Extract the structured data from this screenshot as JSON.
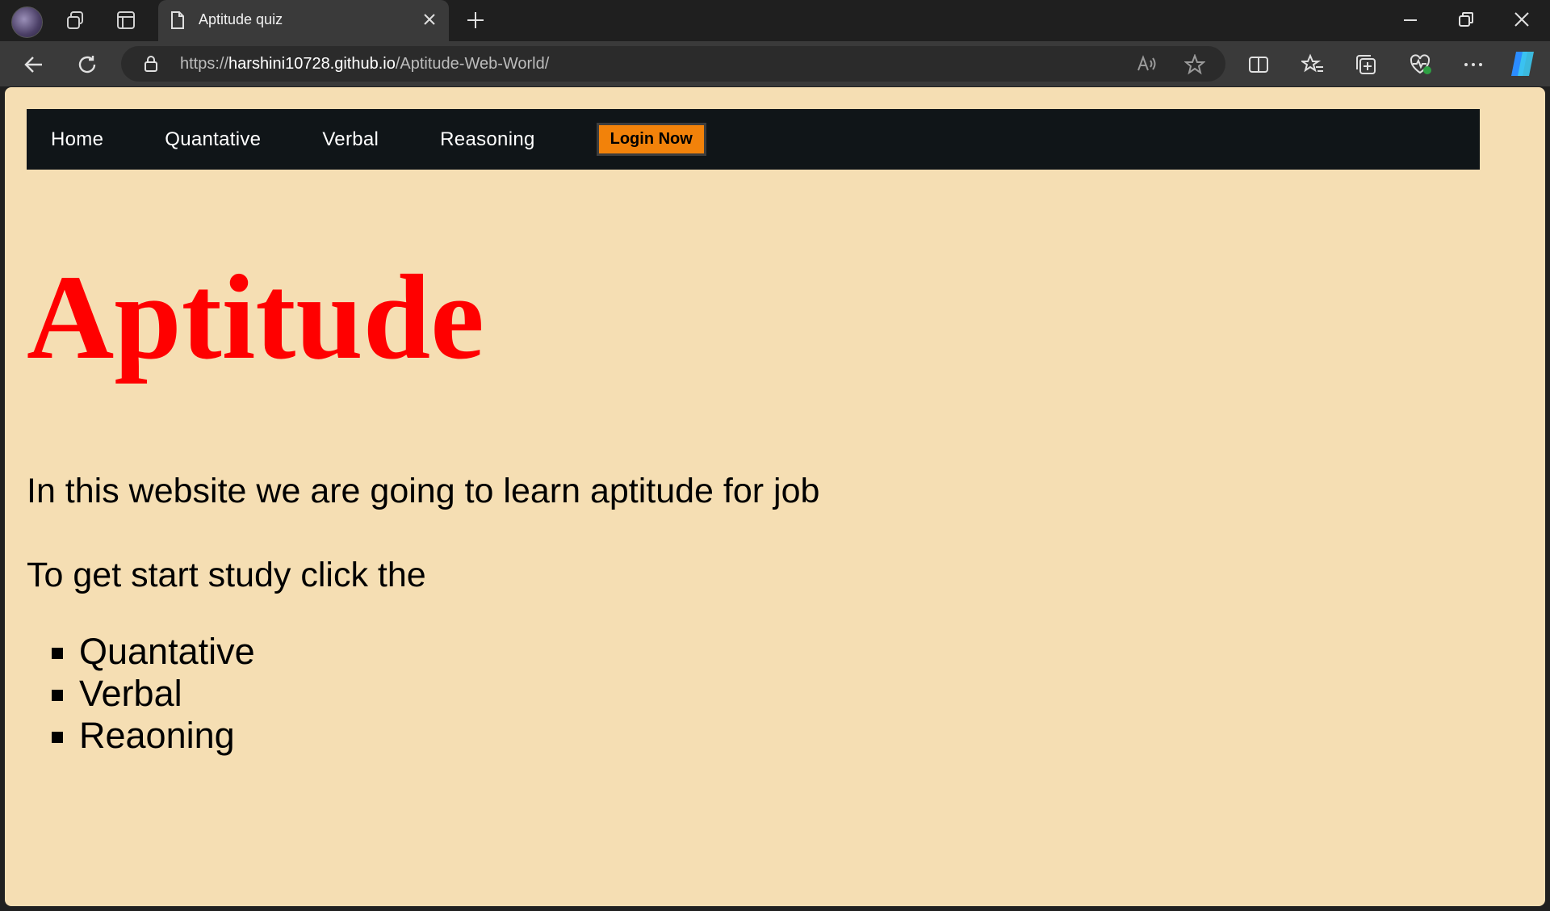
{
  "browser": {
    "tab_title": "Aptitude quiz",
    "url_scheme": "https://",
    "url_host": "harshini10728.github.io",
    "url_path": "/Aptitude-Web-World/"
  },
  "nav": {
    "links": [
      "Home",
      "Quantative",
      "Verbal",
      "Reasoning"
    ],
    "login_label": "Login Now"
  },
  "hero": {
    "title": "Aptitude"
  },
  "content": {
    "intro": "In this website we are going to learn aptitude for job",
    "start": "To get start study click the",
    "topics": [
      "Quantative",
      "Verbal",
      "Reaoning"
    ]
  },
  "colors": {
    "page_bg": "#f5deb3",
    "nav_bg": "#101518",
    "title": "#ff0000",
    "login_bg": "#f2820a"
  }
}
